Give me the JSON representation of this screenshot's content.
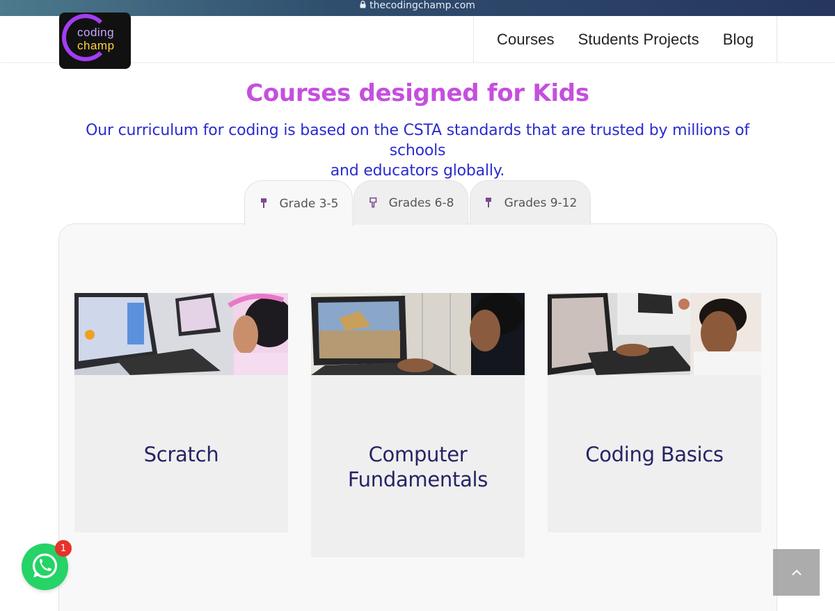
{
  "browser": {
    "url": "thecodingchamp.com"
  },
  "logo": {
    "line1": "coding",
    "line2": "champ"
  },
  "nav": {
    "items": [
      "Courses",
      "Students Projects",
      "Blog"
    ]
  },
  "hero": {
    "title": "Courses designed for Kids",
    "subtitle_line1": "Our curriculum for coding is based on the CSTA standards that are trusted by millions of schools",
    "subtitle_line2": "and educators globally."
  },
  "tabs": [
    {
      "label": "Grade 3-5",
      "active": true
    },
    {
      "label": "Grades 6-8",
      "active": false
    },
    {
      "label": "Grades 9-12",
      "active": false
    }
  ],
  "courses": [
    {
      "line1": "Scratch",
      "line2": ""
    },
    {
      "line1": "Computer",
      "line2": "Fundamentals"
    },
    {
      "line1": "Coding Basics",
      "line2": ""
    }
  ],
  "whatsapp": {
    "badge": "1"
  },
  "colors": {
    "title": "#c54fde",
    "subtitle": "#2b2bd0",
    "course_label": "#262466",
    "whatsapp": "#25d366",
    "badge": "#e8322b"
  }
}
